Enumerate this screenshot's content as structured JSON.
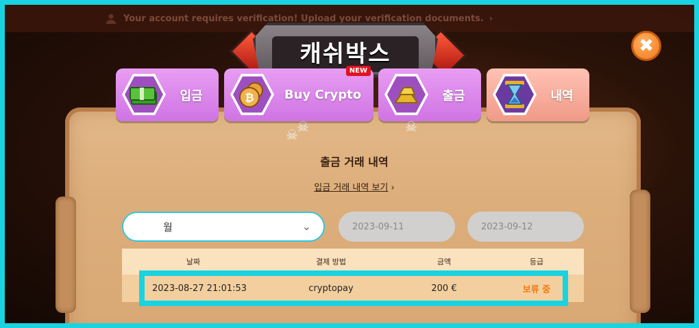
{
  "notice": {
    "text": "Your account requires verification! Upload your verification documents."
  },
  "header": {
    "title": "캐쉬박스"
  },
  "tabs": [
    {
      "label": "입금",
      "icon": "cash-stack-icon"
    },
    {
      "label": "Buy Crypto",
      "icon": "bitcoin-coin-icon",
      "badge": "NEW"
    },
    {
      "label": "출금",
      "icon": "gold-bars-icon"
    },
    {
      "label": "내역",
      "icon": "hourglass-icon"
    }
  ],
  "section": {
    "title": "출금 거래 내역",
    "link": "입금 거래 내역 보기"
  },
  "filters": {
    "period": "월",
    "date_from": "2023-09-11",
    "date_to": "2023-09-12"
  },
  "table": {
    "headers": [
      "날짜",
      "결제 방법",
      "금액",
      "등급"
    ],
    "rows": [
      {
        "date": "2023-08-27 21:01:53",
        "method": "cryptopay",
        "amount": "200 €",
        "status": "보류 중"
      }
    ]
  },
  "colors": {
    "accent": "#19d3e0",
    "tab_pink": "#e89df2",
    "tab_peach": "#ffc2b4",
    "status_pending": "#f07a10",
    "close": "#f07a1a"
  }
}
